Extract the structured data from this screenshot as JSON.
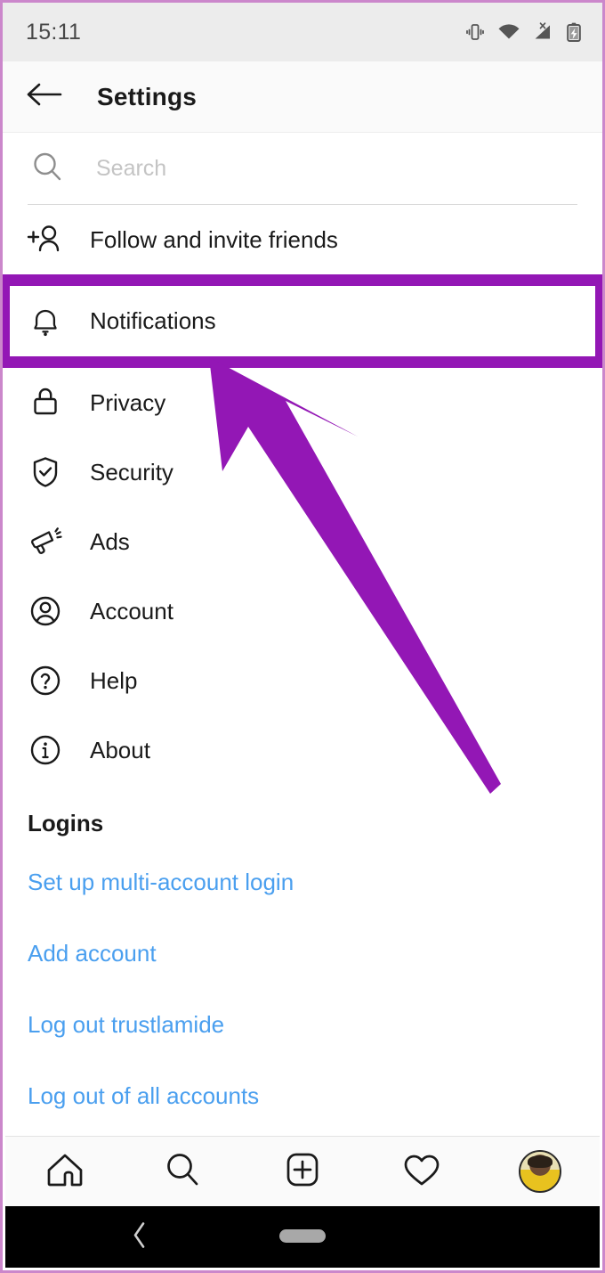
{
  "status_bar": {
    "time": "15:11",
    "icons": [
      "vibrate-icon",
      "wifi-icon",
      "cellular-no-service-icon",
      "battery-charging-icon"
    ]
  },
  "app_bar": {
    "back_icon": "back-arrow-icon",
    "title": "Settings"
  },
  "search": {
    "icon": "search-icon",
    "placeholder": "Search",
    "value": ""
  },
  "menu": {
    "items": [
      {
        "label": "Follow and invite friends",
        "icon": "add-person-icon",
        "highlighted": false
      },
      {
        "label": "Notifications",
        "icon": "bell-icon",
        "highlighted": true
      },
      {
        "label": "Privacy",
        "icon": "lock-icon",
        "highlighted": false
      },
      {
        "label": "Security",
        "icon": "shield-check-icon",
        "highlighted": false
      },
      {
        "label": "Ads",
        "icon": "megaphone-icon",
        "highlighted": false
      },
      {
        "label": "Account",
        "icon": "person-circle-icon",
        "highlighted": false
      },
      {
        "label": "Help",
        "icon": "question-circle-icon",
        "highlighted": false
      },
      {
        "label": "About",
        "icon": "info-circle-icon",
        "highlighted": false
      }
    ]
  },
  "logins": {
    "title": "Logins",
    "links": [
      "Set up multi-account login",
      "Add account",
      "Log out trustlamide",
      "Log out of all accounts"
    ]
  },
  "bottom_nav": {
    "items": [
      {
        "name": "home-icon"
      },
      {
        "name": "search-icon"
      },
      {
        "name": "add-post-icon"
      },
      {
        "name": "activity-heart-icon"
      },
      {
        "name": "profile-avatar"
      }
    ]
  },
  "android_nav": {
    "back_icon": "chevron-back-icon",
    "home_pill": "home-pill-indicator"
  },
  "annotation": {
    "type": "arrow-pointing-to-notifications",
    "color": "#9317b5",
    "highlight_target": "Notifications"
  },
  "colors": {
    "accent_purple": "#9317b5",
    "link_blue": "#4a9fef",
    "status_bar_bg": "#ececec",
    "app_bar_bg": "#fafafa",
    "frame_border": "#cb87cb"
  }
}
